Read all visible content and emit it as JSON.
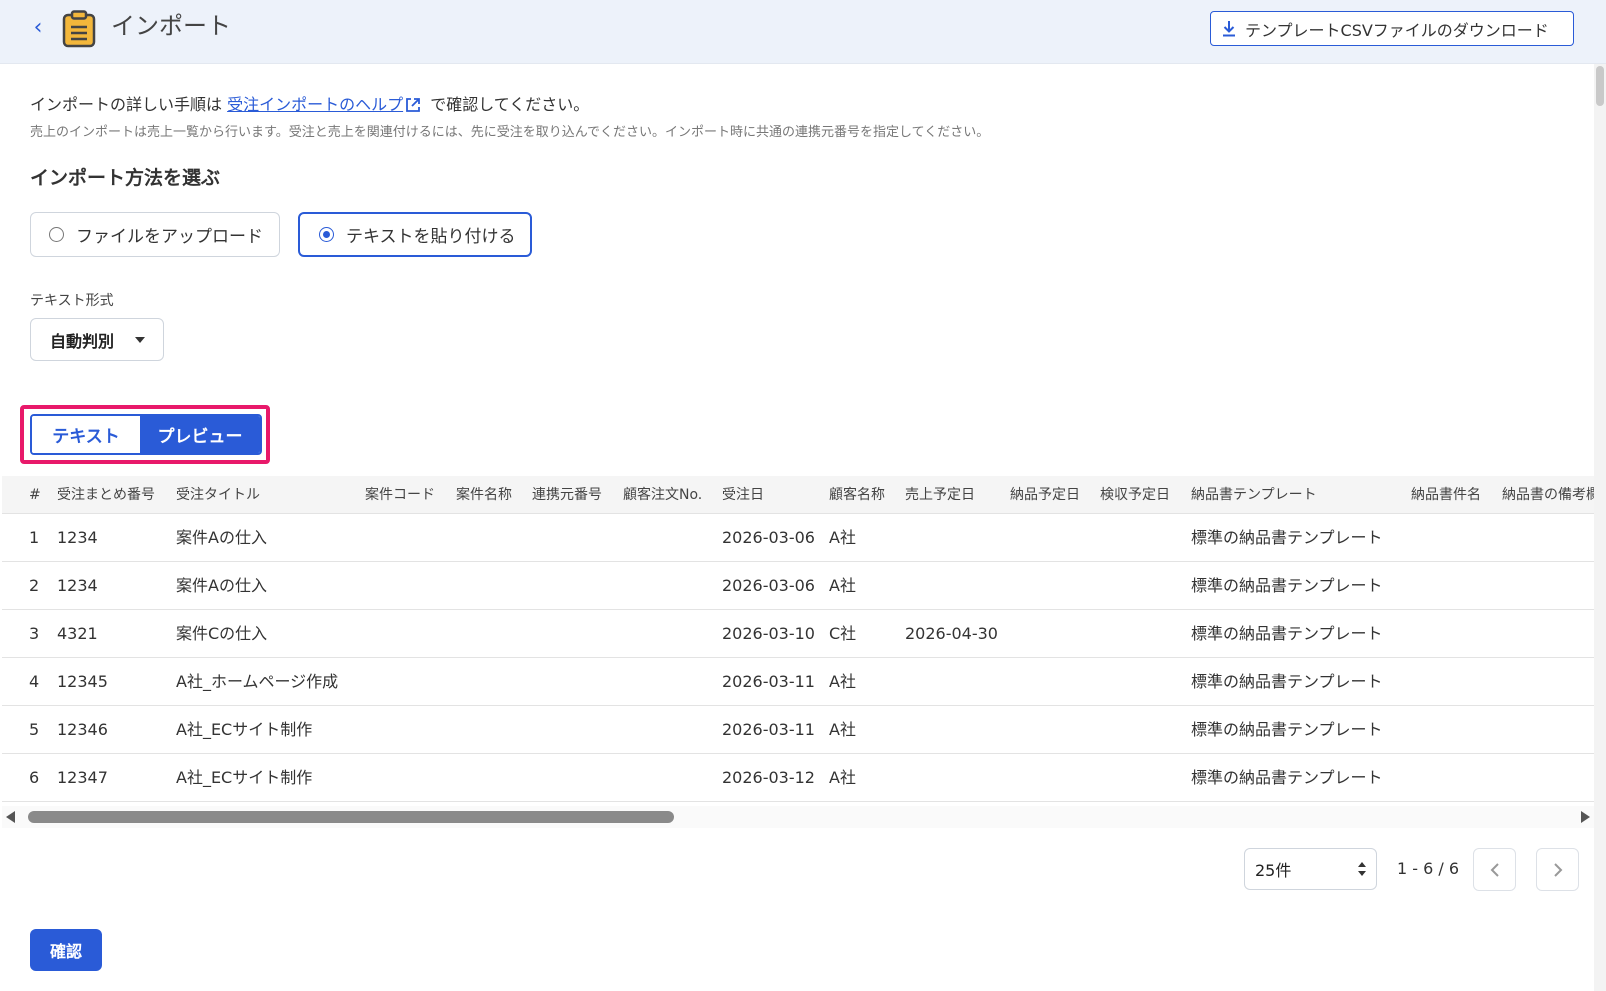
{
  "header": {
    "title": "インポート",
    "template_button_label": "テンプレートCSVファイルのダウンロード"
  },
  "help": {
    "prefix": "インポートの詳しい手順は ",
    "link_text": "受注インポートのヘルプ",
    "suffix": " で確認してください。",
    "note": "売上のインポートは売上一覧から行います。受注と売上を関連付けるには、先に受注を取り込んでください。インポート時に共通の連携元番号を指定してください。"
  },
  "import_method": {
    "title": "インポート方法を選ぶ",
    "options": [
      {
        "label": "ファイルをアップロード",
        "selected": false
      },
      {
        "label": "テキストを貼り付ける",
        "selected": true
      }
    ]
  },
  "text_format": {
    "label": "テキスト形式",
    "value": "自動判別"
  },
  "view_toggle": {
    "text_label": "テキスト",
    "preview_label": "プレビュー",
    "active": "プレビュー"
  },
  "table": {
    "columns": [
      "#",
      "受注まとめ番号",
      "受注タイトル",
      "案件コード",
      "案件名称",
      "連携元番号",
      "顧客注文No.",
      "受注日",
      "顧客名称",
      "売上予定日",
      "納品予定日",
      "検収予定日",
      "納品書テンプレート",
      "納品書件名",
      "納品書の備考欄"
    ],
    "rows": [
      [
        "1",
        "1234",
        "案件Aの仕入",
        "",
        "",
        "",
        "",
        "2026-03-06",
        "A社",
        "",
        "",
        "",
        "標準の納品書テンプレート",
        "",
        ""
      ],
      [
        "2",
        "1234",
        "案件Aの仕入",
        "",
        "",
        "",
        "",
        "2026-03-06",
        "A社",
        "",
        "",
        "",
        "標準の納品書テンプレート",
        "",
        ""
      ],
      [
        "3",
        "4321",
        "案件Cの仕入",
        "",
        "",
        "",
        "",
        "2026-03-10",
        "C社",
        "2026-04-30",
        "",
        "",
        "標準の納品書テンプレート",
        "",
        ""
      ],
      [
        "4",
        "12345",
        "A社_ホームページ作成",
        "",
        "",
        "",
        "",
        "2026-03-11",
        "A社",
        "",
        "",
        "",
        "標準の納品書テンプレート",
        "",
        ""
      ],
      [
        "5",
        "12346",
        "A社_ECサイト制作",
        "",
        "",
        "",
        "",
        "2026-03-11",
        "A社",
        "",
        "",
        "",
        "標準の納品書テンプレート",
        "",
        ""
      ],
      [
        "6",
        "12347",
        "A社_ECサイト制作",
        "",
        "",
        "",
        "",
        "2026-03-12",
        "A社",
        "",
        "",
        "",
        "標準の納品書テンプレート",
        "",
        ""
      ]
    ]
  },
  "pagination": {
    "per_page": "25件",
    "range": "1 - 6 / 6"
  },
  "confirm_label": "確認",
  "colors": {
    "primary": "#2a5bd7",
    "header_bg": "#edf2fa",
    "highlight": "#e8196a",
    "clipboard": "#f3b73b"
  },
  "icons": [
    "chevron-left-icon",
    "clipboard-icon",
    "download-icon",
    "external-link-icon",
    "caret-down-icon",
    "chevron-right-icon"
  ]
}
